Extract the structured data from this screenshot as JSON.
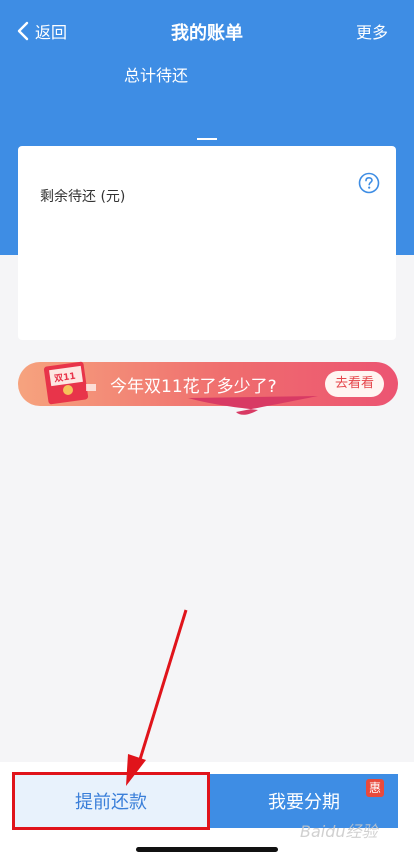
{
  "nav": {
    "back_label": "返回",
    "title": "我的账单",
    "more_label": "更多"
  },
  "summary": {
    "total_label": "总计待还",
    "remaining_label": "剩余待还 (元)"
  },
  "promo": {
    "text": "今年双11花了多少了?",
    "button_label": "去看看",
    "envelope_text": "双11"
  },
  "bottom_bar": {
    "prepay_label": "提前还款",
    "installment_label": "我要分期",
    "installment_badge": "惠"
  },
  "watermark": "Baidu经验",
  "colors": {
    "primary": "#3e8de4",
    "annotation": "#e0141b",
    "promo_start": "#f6a37e",
    "promo_end": "#ec5472"
  }
}
